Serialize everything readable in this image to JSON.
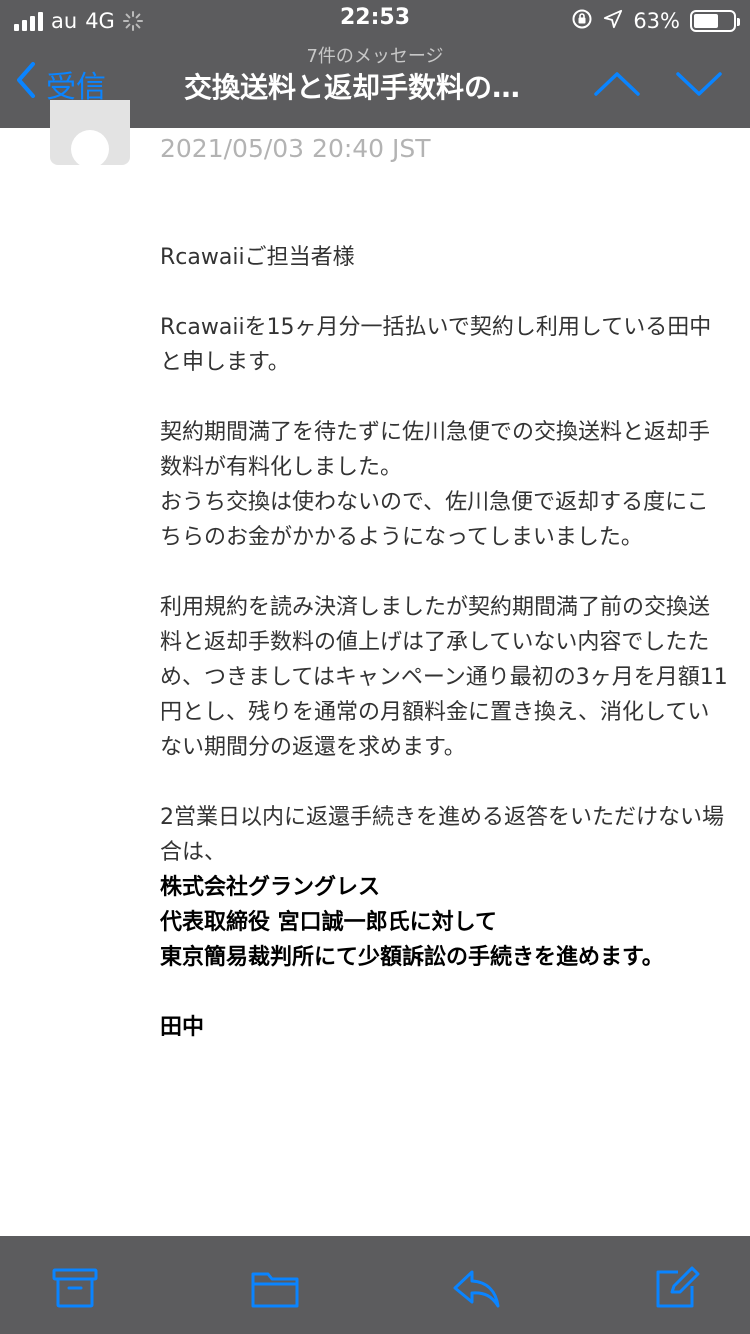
{
  "status_bar": {
    "carrier": "au",
    "network": "4G",
    "time": "22:53",
    "battery_percent": "63%",
    "battery_level": 0.63
  },
  "nav": {
    "message_count": "7件のメッセージ",
    "back_label": "受信",
    "title": "交換送料と返却手数料の…"
  },
  "message": {
    "timestamp": "2021/05/03 20:40 JST",
    "greeting": "Rcawaiiご担当者様",
    "para1": "Rcawaiiを15ヶ月分一括払いで契約し利用している田中と申します。",
    "para2_line1": "契約期間満了を待たずに佐川急便での交換送料と返却手数料が有料化しました。",
    "para2_line2": "おうち交換は使わないので、佐川急便で返却する度にこちらのお金がかかるようになってしまいました。",
    "para3": "利用規約を読み決済しましたが契約期間満了前の交換送料と返却手数料の値上げは了承していない内容でしたため、つきましてはキャンペーン通り最初の3ヶ月を月額11円とし、残りを通常の月額料金に置き換え、消化していない期間分の返還を求めます。",
    "para4": "2営業日以内に返還手続きを進める返答をいただけない場合は、",
    "bold1": "株式会社グラングレス",
    "bold2": "代表取締役 宮口誠一郎氏に対して",
    "bold3": "東京簡易裁判所にて少額訴訟の手続きを進めます。",
    "signature": "田中"
  },
  "colors": {
    "header_bg": "#5c5c5e",
    "accent_blue": "#0a84ff",
    "timestamp_gray": "#b3b3b3"
  },
  "toolbar": {
    "icons": [
      "archive-icon",
      "folder-icon",
      "reply-icon",
      "compose-icon"
    ]
  }
}
